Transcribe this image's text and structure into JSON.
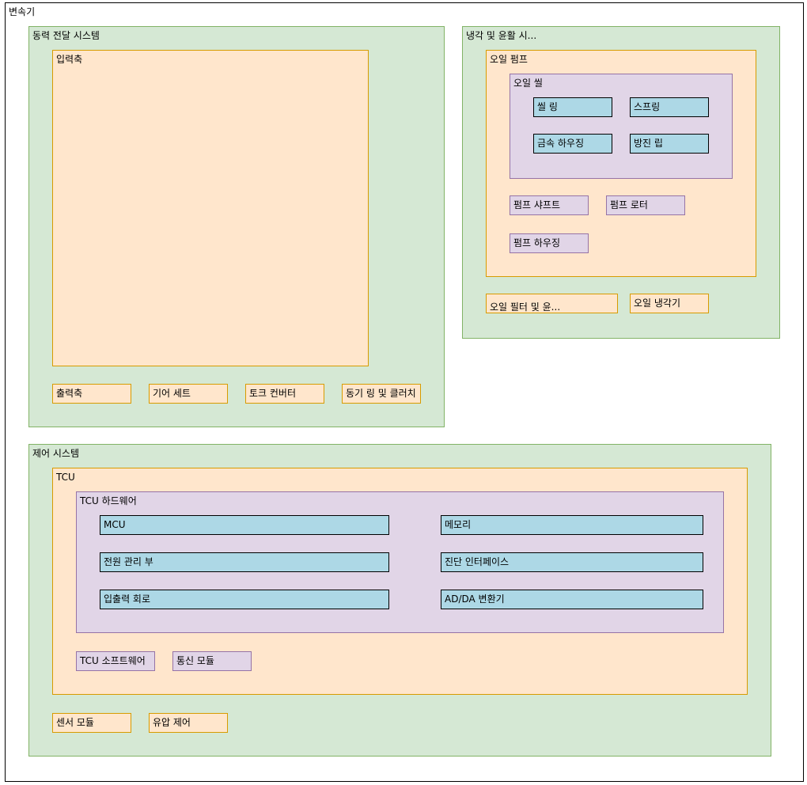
{
  "diagram": {
    "root": {
      "label": "변속기"
    },
    "powertrain": {
      "label": "동력 전달 시스템",
      "input_shaft": "입력축",
      "output_shaft": "출력축",
      "gear_set": "기어 세트",
      "torque_converter": "토크 컨버터",
      "sync_clutch": "동기 링 및 클러치"
    },
    "cooling": {
      "label": "냉각 및 윤활 시...",
      "oil_pump": {
        "label": "오일 펌프",
        "oil_seal": {
          "label": "오일 씰",
          "seal_ring": "씰 링",
          "spring": "스프링",
          "metal_housing": "금속 하우징",
          "dust_lip": "방진 립"
        },
        "pump_shaft": "펌프 샤프트",
        "pump_rotor": "펌프 로터",
        "pump_housing": "펌프 하우징"
      },
      "oil_filter": "오일 필터 및 윤...",
      "oil_cooler": "오일 냉각기"
    },
    "control": {
      "label": "제어 시스템",
      "tcu": {
        "label": "TCU",
        "hardware": {
          "label": "TCU 하드웨어",
          "mcu": "MCU",
          "memory": "메모리",
          "power_mgmt": "전원 관리 부",
          "diag_interface": "진단 인터페이스",
          "io_circuit": "입출력 회로",
          "adda": "AD/DA 변환기"
        },
        "software": "TCU 소프트웨어",
        "comm_module": "통신 모듈"
      },
      "sensor_module": "센서 모듈",
      "hydraulic_control": "유압 제어"
    }
  }
}
